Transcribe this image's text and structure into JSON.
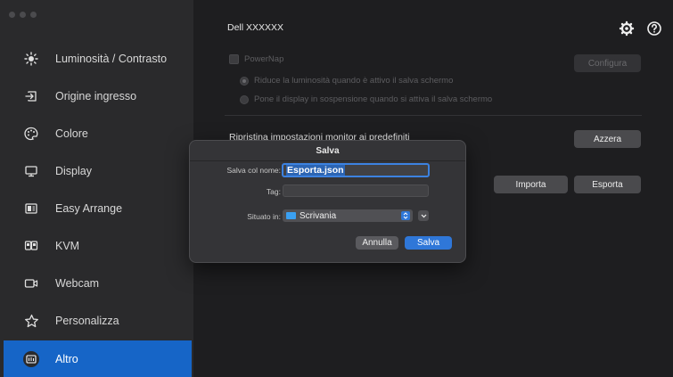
{
  "window": {
    "title": "Dell XXXXXX"
  },
  "sidebar": {
    "items": [
      {
        "label": "Luminosità / Contrasto",
        "icon": "sun-icon"
      },
      {
        "label": "Origine ingresso",
        "icon": "input-source-icon"
      },
      {
        "label": "Colore",
        "icon": "color-palette-icon"
      },
      {
        "label": "Display",
        "icon": "monitor-icon"
      },
      {
        "label": "Easy Arrange",
        "icon": "layout-icon"
      },
      {
        "label": "KVM",
        "icon": "kvm-icon"
      },
      {
        "label": "Webcam",
        "icon": "webcam-icon"
      },
      {
        "label": "Personalizza",
        "icon": "star-icon"
      },
      {
        "label": "Altro",
        "icon": "other-icon"
      }
    ],
    "active_index": 8
  },
  "main": {
    "powernap_label": "PowerNap",
    "radio1": "Riduce la luminosità quando è attivo il salva schermo",
    "radio2": "Pone il display in sospensione quando si attiva il salva schermo",
    "configure_button": "Configura",
    "restore_label": "Ripristina impostazioni monitor ai predefiniti",
    "reset_button": "Azzera",
    "import_button": "Importa",
    "export_button": "Esporta"
  },
  "dialog": {
    "title": "Salva",
    "save_as_label": "Salva col nome:",
    "save_as_value": "Esporta.json",
    "tags_label": "Tag:",
    "tags_value": "",
    "location_label": "Situato in:",
    "location_value": "Scrivania",
    "cancel_button": "Annulla",
    "save_button": "Salva"
  },
  "colors": {
    "accent": "#1665c7",
    "sidebar": "#2a2a2c",
    "background": "#1e1e20"
  }
}
